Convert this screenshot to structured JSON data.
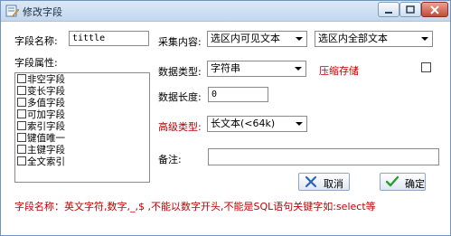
{
  "window": {
    "title": "修改字段",
    "icon": "edit-app-icon"
  },
  "form": {
    "field_name_label": "字段名称:",
    "field_name_value": "tittle",
    "attributes_label": "字段属性:",
    "attributes": [
      {
        "label": "非空字段",
        "checked": false
      },
      {
        "label": "变长字段",
        "checked": false
      },
      {
        "label": "多值字段",
        "checked": false
      },
      {
        "label": "可加字段",
        "checked": false
      },
      {
        "label": "索引字段",
        "checked": false
      },
      {
        "label": "键值唯一",
        "checked": false
      },
      {
        "label": "主键字段",
        "checked": false
      },
      {
        "label": "全文索引",
        "checked": false
      }
    ],
    "collect_label": "采集内容:",
    "collect_select_1": "选区内可见文本",
    "collect_select_2": "选区内全部文本",
    "data_type_label": "数据类型:",
    "data_type_value": "字符串",
    "compress_label": "压缩存储",
    "compress_checked": false,
    "data_length_label": "数据长度:",
    "data_length_value": "0",
    "advanced_type_label": "高级类型:",
    "advanced_type_value": "长文本(<64k)",
    "remark_label": "备注:",
    "remark_value": ""
  },
  "buttons": {
    "cancel_label": "取消",
    "ok_label": "确定"
  },
  "footer_hint": "字段名称：英文字符,数字,_,$ ,不能以数字开头,不能是SQL语句关键字如:select等"
}
